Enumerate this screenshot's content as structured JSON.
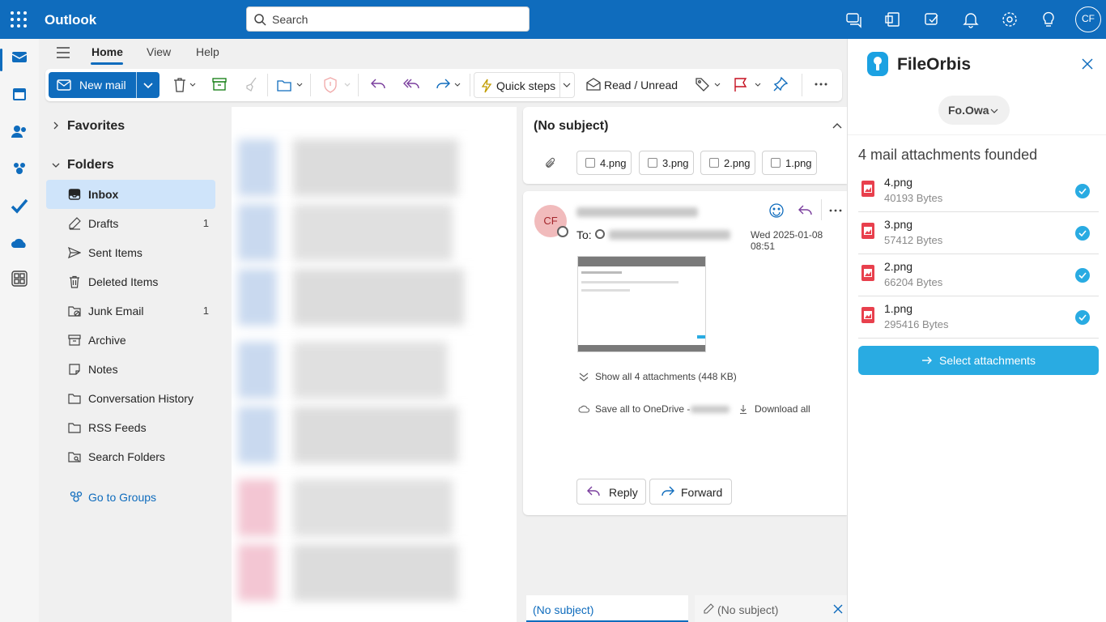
{
  "app": {
    "name": "Outlook",
    "user_initials": "CF"
  },
  "search": {
    "placeholder": "Search"
  },
  "ribbon_tabs": [
    {
      "label": "Home"
    },
    {
      "label": "View"
    },
    {
      "label": "Help"
    }
  ],
  "toolbar": {
    "new_mail": "New mail",
    "quick_steps": "Quick steps",
    "read_unread": "Read / Unread"
  },
  "folders": {
    "favorites_label": "Favorites",
    "folders_label": "Folders",
    "items": [
      {
        "label": "Inbox",
        "count": "",
        "icon": "inbox-icon"
      },
      {
        "label": "Drafts",
        "count": "1",
        "icon": "drafts-icon"
      },
      {
        "label": "Sent Items",
        "count": "",
        "icon": "sent-icon"
      },
      {
        "label": "Deleted Items",
        "count": "",
        "icon": "trash-icon"
      },
      {
        "label": "Junk Email",
        "count": "1",
        "icon": "junk-icon"
      },
      {
        "label": "Archive",
        "count": "",
        "icon": "archive-icon"
      },
      {
        "label": "Notes",
        "count": "",
        "icon": "notes-icon"
      },
      {
        "label": "Conversation History",
        "count": "",
        "icon": "folder-icon"
      },
      {
        "label": "RSS Feeds",
        "count": "",
        "icon": "folder-icon"
      },
      {
        "label": "Search Folders",
        "count": "",
        "icon": "search-folder-icon"
      }
    ],
    "go_to_groups": "Go to Groups"
  },
  "message": {
    "subject": "(No subject)",
    "attachments": [
      "4.png",
      "3.png",
      "2.png",
      "1.png"
    ],
    "sender_initials": "CF",
    "to_label": "To:",
    "date": "Wed 2025-01-08 08:51",
    "show_all": "Show all 4 attachments (448 KB)",
    "save_onedrive": "Save all to OneDrive -",
    "download_all": "Download all",
    "reply": "Reply",
    "forward": "Forward"
  },
  "bottom_tabs": [
    {
      "label": "(No subject)"
    },
    {
      "label": "(No subject)"
    }
  ],
  "fileorbis": {
    "title": "FileOrbis",
    "account": "Fo.Owa",
    "heading": "4 mail attachments founded",
    "files": [
      {
        "name": "4.png",
        "size": "40193 Bytes"
      },
      {
        "name": "3.png",
        "size": "57412 Bytes"
      },
      {
        "name": "2.png",
        "size": "66204 Bytes"
      },
      {
        "name": "1.png",
        "size": "295416 Bytes"
      }
    ],
    "select_button": "Select attachments"
  },
  "colors": {
    "brand": "#0f6cbd",
    "accent": "#29abe2",
    "selected_folder": "#cfe4fa"
  }
}
